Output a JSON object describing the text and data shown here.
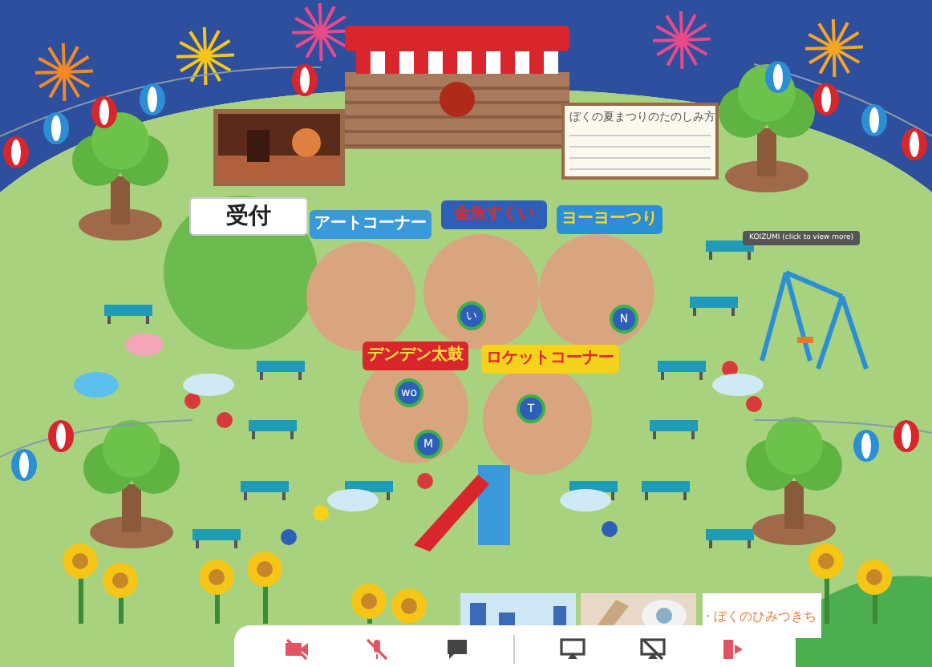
{
  "notice_board": {
    "title": "ぼくの夏まつりのたのしみ方"
  },
  "booths": [
    {
      "name": "受付",
      "kind": "tent",
      "color": "#ffffff"
    },
    {
      "name": "アートコーナー",
      "kind": "stall",
      "color": "#3a9ad9"
    },
    {
      "name": "金魚すくい",
      "kind": "stall",
      "color": "#2d5fb8"
    },
    {
      "name": "ヨーヨーつり",
      "kind": "stall",
      "color": "#2a8fd6"
    },
    {
      "name": "デンデン太鼓",
      "kind": "stall",
      "color": "#d8262c"
    },
    {
      "name": "ロケットコーナー",
      "kind": "stall",
      "color": "#f5d21c"
    }
  ],
  "tooltip": "KOIZUMI (click to view more)",
  "avatars": [
    {
      "label": "T"
    },
    {
      "label": "い"
    },
    {
      "label": "N"
    },
    {
      "label": "wo"
    },
    {
      "label": "M"
    }
  ],
  "ad": {
    "title": "ぼくのひみつきち"
  },
  "toolbar": [
    {
      "kind": "camera",
      "off": true
    },
    {
      "kind": "microphone",
      "off": true
    },
    {
      "kind": "chat",
      "off": false
    },
    {
      "kind": "screen-share",
      "off": false
    },
    {
      "kind": "screen-share",
      "off": true
    },
    {
      "kind": "leave",
      "off": false
    }
  ]
}
